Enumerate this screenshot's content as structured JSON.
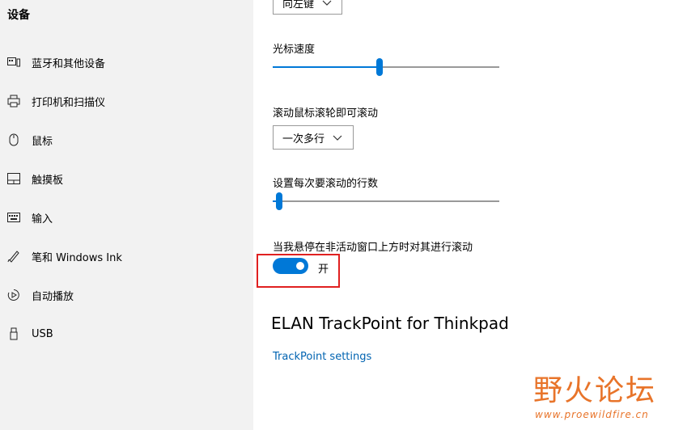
{
  "sidebar": {
    "title": "设备",
    "items": [
      {
        "label": "蓝牙和其他设备",
        "icon": "bluetooth-devices-icon"
      },
      {
        "label": "打印机和扫描仪",
        "icon": "printer-icon"
      },
      {
        "label": "鼠标",
        "icon": "mouse-icon"
      },
      {
        "label": "触摸板",
        "icon": "touchpad-icon"
      },
      {
        "label": "输入",
        "icon": "keyboard-icon"
      },
      {
        "label": "笔和 Windows Ink",
        "icon": "pen-icon"
      },
      {
        "label": "自动播放",
        "icon": "autoplay-icon"
      },
      {
        "label": "USB",
        "icon": "usb-icon"
      }
    ]
  },
  "main": {
    "primary_button_select": {
      "value": "向左键"
    },
    "cursor_speed": {
      "label": "光标速度",
      "level": 0.47
    },
    "scroll_mode": {
      "label": "滚动鼠标滚轮即可滚动",
      "value": "一次多行"
    },
    "scroll_lines": {
      "label": "设置每次要滚动的行数",
      "level": 0.03
    },
    "inactive_scroll": {
      "label": "当我悬停在非活动窗口上方时对其进行滚动",
      "state": "开",
      "on": true
    },
    "section_heading": "ELAN TrackPoint for Thinkpad",
    "trackpoint_link": "TrackPoint settings"
  },
  "watermark": {
    "title": "野火论坛",
    "url": "www.proewildfire.cn"
  },
  "colors": {
    "accent": "#0078d7",
    "highlight_border": "#e02020",
    "watermark": "#e8742a",
    "sidebar_bg": "#f2f2f2"
  }
}
